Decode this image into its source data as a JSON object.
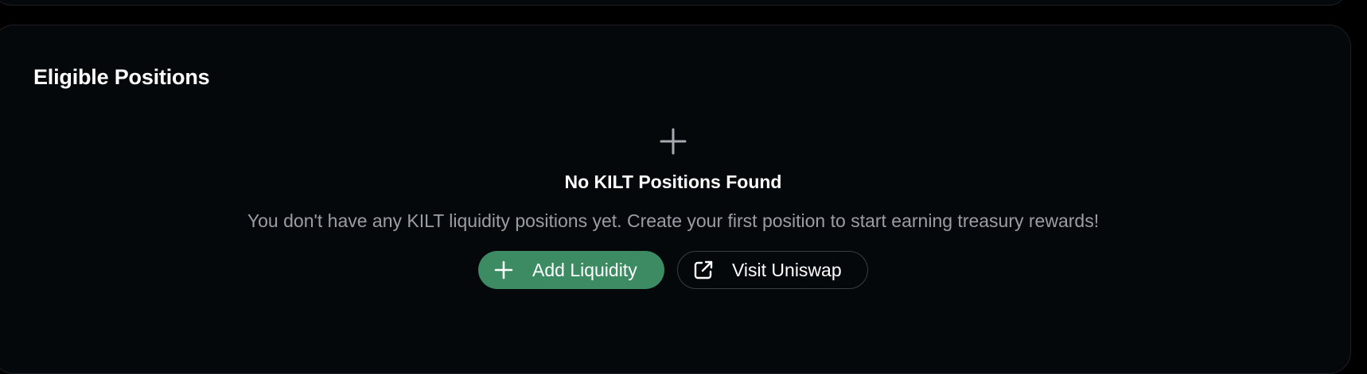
{
  "section": {
    "title": "Eligible Positions"
  },
  "empty_state": {
    "icon": "plus-icon",
    "title": "No KILT Positions Found",
    "description": "You don't have any KILT liquidity positions yet. Create your first position to start earning treasury rewards!"
  },
  "actions": {
    "add_liquidity": {
      "label": "Add Liquidity",
      "icon": "plus-icon"
    },
    "visit_uniswap": {
      "label": "Visit Uniswap",
      "icon": "external-link-icon"
    }
  },
  "colors": {
    "background": "#000000",
    "card": "#05080b",
    "card_border": "#1c1f24",
    "primary_button": "#3d8b63",
    "muted_text": "#9a9ea4",
    "icon_gray": "#a7abb1"
  }
}
